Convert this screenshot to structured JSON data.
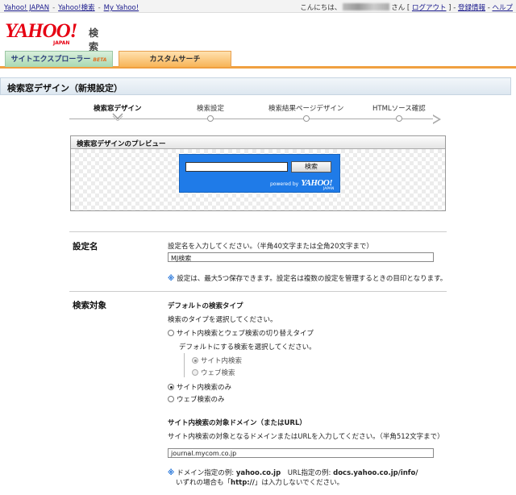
{
  "topbar": {
    "links": [
      "Yahoo! JAPAN",
      "Yahoo!検索",
      "My Yahoo!"
    ],
    "sep": "-",
    "greeting_prefix": "こんにちは、",
    "greeting_suffix": "さん",
    "logout": "ログアウト",
    "account": "登録情報",
    "help": "ヘルプ"
  },
  "logo": {
    "brand": "YAHOO!",
    "sub": "JAPAN",
    "service": "検索"
  },
  "tabs": [
    {
      "label": "サイトエクスプローラー",
      "badge": "BETA"
    },
    {
      "label": "カスタムサーチ"
    }
  ],
  "page_title": "検索窓デザイン（新規設定）",
  "steps": [
    "検索窓デザイン",
    "検索設定",
    "検索結果ページデザイン",
    "HTMLソース確認"
  ],
  "preview": {
    "title": "検索窓デザインのプレビュー",
    "search_button": "検索",
    "powered_by": "powered by",
    "powered_brand": "YAHOO!",
    "powered_sub": "JAPAN"
  },
  "setting_name": {
    "label": "設定名",
    "instruction": "設定名を入力してください。（半角40文字または全角20文字まで）",
    "value": "MJ検索",
    "note_mark": "※",
    "note": "設定は、最大5つ保存できます。設定名は複数の設定を管理するときの目印となります。"
  },
  "search_target": {
    "label": "検索対象",
    "default_type_title": "デフォルトの検索タイプ",
    "default_type_instruction": "検索のタイプを選択してください。",
    "option_switch": "サイト内検索とウェブ検索の切り替えタイプ",
    "default_select_instruction": "デフォルトにする検索を選択してください。",
    "sub_site": "サイト内検索",
    "sub_web": "ウェブ検索",
    "option_site_only": "サイト内検索のみ",
    "option_web_only": "ウェブ検索のみ",
    "domain_title": "サイト内検索の対象ドメイン（またはURL）",
    "domain_instruction": "サイト内検索の対象となるドメインまたはURLを入力してください。（半角512文字まで）",
    "domain_value": "journal.mycom.co.jp",
    "example_mark": "※",
    "example_line1_a": "ドメイン指定の例: ",
    "example_domain": "yahoo.co.jp",
    "example_line1_b": "　URL指定の例: ",
    "example_url": "docs.yahoo.co.jp/info/",
    "example_line2_a": "いずれの場合も「",
    "example_http": "http://",
    "example_line2_b": "」は入力しないでください。"
  }
}
